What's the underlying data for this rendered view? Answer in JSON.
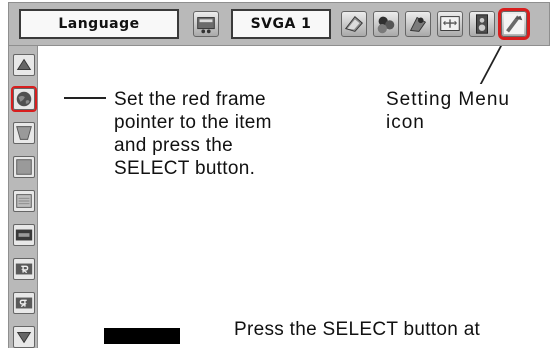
{
  "menubar": {
    "language_label": "Language",
    "resolution_label": "SVGA 1",
    "icons": [
      "pc-adjust-icon",
      "image-adjust-icon",
      "color-adjust-icon",
      "image-select-icon",
      "screen-icon",
      "sound-icon",
      "setting-menu-icon"
    ],
    "selected_icon": "setting-menu-icon"
  },
  "sidebar": {
    "icons": [
      "scroll-up-icon",
      "globe-icon",
      "keystone-icon",
      "blue-back-icon",
      "display-icon",
      "logo-icon",
      "ceiling-icon",
      "rear-icon",
      "scroll-down-icon"
    ],
    "selected_icon": "globe-icon"
  },
  "callouts": {
    "left_text": "Set the red frame\npointer to the item\nand press the\nSELECT button.",
    "right_text": "Setting Menu\nicon",
    "bottom_text": "Press the SELECT button at"
  },
  "colors": {
    "frame_bg": "#b9b9b9",
    "selection": "#d81e1e"
  }
}
